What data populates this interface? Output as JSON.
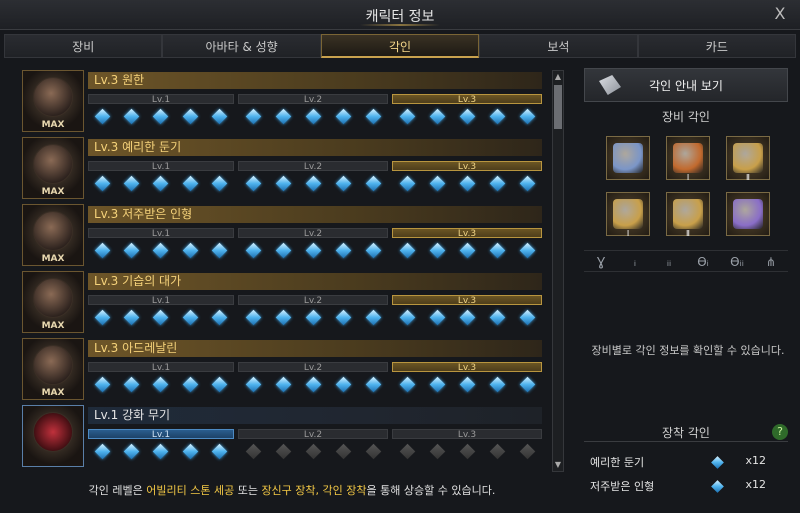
{
  "window": {
    "title": "캐릭터 정보",
    "close": "X"
  },
  "tabs": [
    {
      "label": "장비",
      "active": false
    },
    {
      "label": "아바타 & 성향",
      "active": false
    },
    {
      "label": "각인",
      "active": true
    },
    {
      "label": "보석",
      "active": false
    },
    {
      "label": "카드",
      "active": false
    }
  ],
  "engravings": [
    {
      "name": "Lv.3 원한",
      "level": 3,
      "max": "MAX",
      "levels": [
        "Lv.1",
        "Lv.2",
        "Lv.3"
      ]
    },
    {
      "name": "Lv.3 예리한 둔기",
      "level": 3,
      "max": "MAX",
      "levels": [
        "Lv.1",
        "Lv.2",
        "Lv.3"
      ]
    },
    {
      "name": "Lv.3 저주받은 인형",
      "level": 3,
      "max": "MAX",
      "levels": [
        "Lv.1",
        "Lv.2",
        "Lv.3"
      ]
    },
    {
      "name": "Lv.3 기습의 대가",
      "level": 3,
      "max": "MAX",
      "levels": [
        "Lv.1",
        "Lv.2",
        "Lv.3"
      ]
    },
    {
      "name": "Lv.3 아드레날린",
      "level": 3,
      "max": "MAX",
      "levels": [
        "Lv.1",
        "Lv.2",
        "Lv.3"
      ]
    },
    {
      "name": "Lv.1 강화 무기",
      "level": 1,
      "max": "",
      "levels": [
        "Lv.1",
        "Lv.2",
        "Lv.3"
      ]
    }
  ],
  "footer": {
    "pre": "각인 레벨은 ",
    "hl1": "어빌리티 스톤 세공",
    "mid": " 또는 ",
    "hl2": "장신구 장착, 각인 장착",
    "post": "을 통해 상승할 수 있습니다."
  },
  "side": {
    "guide_button": "각인 안내 보기",
    "equip_title": "장비 각인",
    "equip_slots": [
      {
        "icon": "ability-stone-icon",
        "roman": "",
        "color": "#7b96c8"
      },
      {
        "icon": "necklace-icon",
        "roman": "Ⅰ",
        "color": "#c26a2e"
      },
      {
        "icon": "earring-icon",
        "roman": "Ⅱ",
        "color": "#c9a04a"
      },
      {
        "icon": "ring-icon",
        "roman": "Ⅰ",
        "color": "#c9a04a"
      },
      {
        "icon": "ring-icon",
        "roman": "Ⅱ",
        "color": "#c9a04a"
      },
      {
        "icon": "stone-crystal-icon",
        "roman": "",
        "color": "#8a6ec8"
      }
    ],
    "slot_icons": [
      "Ɣ",
      "ᵢ",
      "ᵢᵢ",
      "Ɵᵢ",
      "Ɵᵢᵢ",
      "⋔"
    ],
    "info_text": "장비별로 각인 정보를 확인할 수 있습니다.",
    "worn_title": "장착 각인",
    "help": "?",
    "worn": [
      {
        "name": "예리한 둔기",
        "count": "x12"
      },
      {
        "name": "저주받은 인형",
        "count": "x12"
      }
    ]
  }
}
